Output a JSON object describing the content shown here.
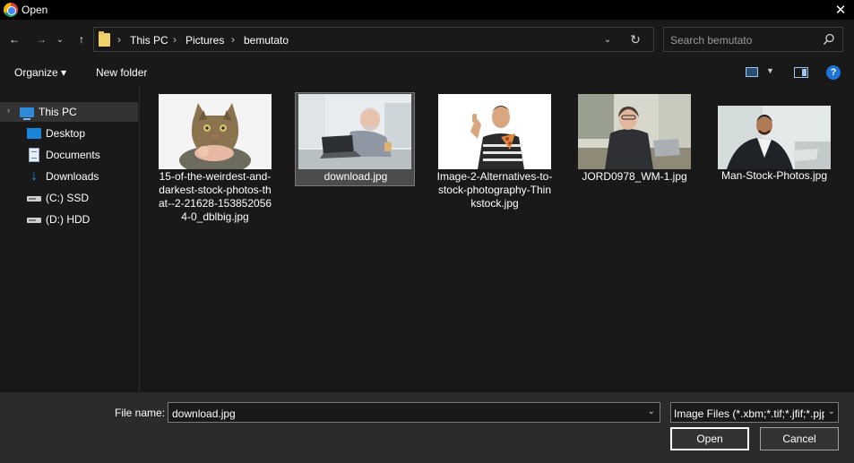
{
  "window": {
    "title": "Open",
    "close_glyph": "✕"
  },
  "nav": {
    "back_glyph": "←",
    "forward_glyph": "→",
    "recent_glyph": "⌄",
    "up_glyph": "↑",
    "breadcrumbs": [
      "This PC",
      "Pictures",
      "bemutato"
    ],
    "separator": "›",
    "search_placeholder": "Search bemutato"
  },
  "toolbar": {
    "organize_label": "Organize ▾",
    "new_folder_label": "New folder",
    "help_glyph": "?"
  },
  "sidebar": {
    "items": [
      {
        "label": "This PC",
        "icon": "computer-icon"
      },
      {
        "label": "Desktop",
        "icon": "desktop-icon"
      },
      {
        "label": "Documents",
        "icon": "documents-icon"
      },
      {
        "label": "Downloads",
        "icon": "downloads-icon"
      },
      {
        "label": "(C:) SSD",
        "icon": "drive-icon"
      },
      {
        "label": "(D:) HDD",
        "icon": "drive-icon"
      }
    ]
  },
  "files": [
    {
      "name": "15-of-the-weirdest-and-darkest-stock-photos-that--2-21628-1538520564-0_dblbig.jpg",
      "thumb": "cat-with-baby"
    },
    {
      "name": "download.jpg",
      "thumb": "old-man-laptop",
      "selected": true
    },
    {
      "name": "Image-2-Alternatives-to-stock-photography-Thinkstock.jpg",
      "thumb": "man-thumbs-up-pizza"
    },
    {
      "name": "JORD0978_WM-1.jpg",
      "thumb": "woman-at-desk"
    },
    {
      "name": "Man-Stock-Photos.jpg",
      "thumb": "man-in-suit"
    }
  ],
  "footer": {
    "file_name_label": "File name:",
    "file_name_value": "download.jpg",
    "file_type_value": "Image Files (*.xbm;*.tif;*.jfif;*.pjp",
    "open_label": "Open",
    "cancel_label": "Cancel"
  },
  "colors": {
    "background": "#191919",
    "titlebar": "#000000",
    "footer": "#2b2b2b",
    "selection": "#4c4c4c",
    "accent": "#1e73d8"
  }
}
